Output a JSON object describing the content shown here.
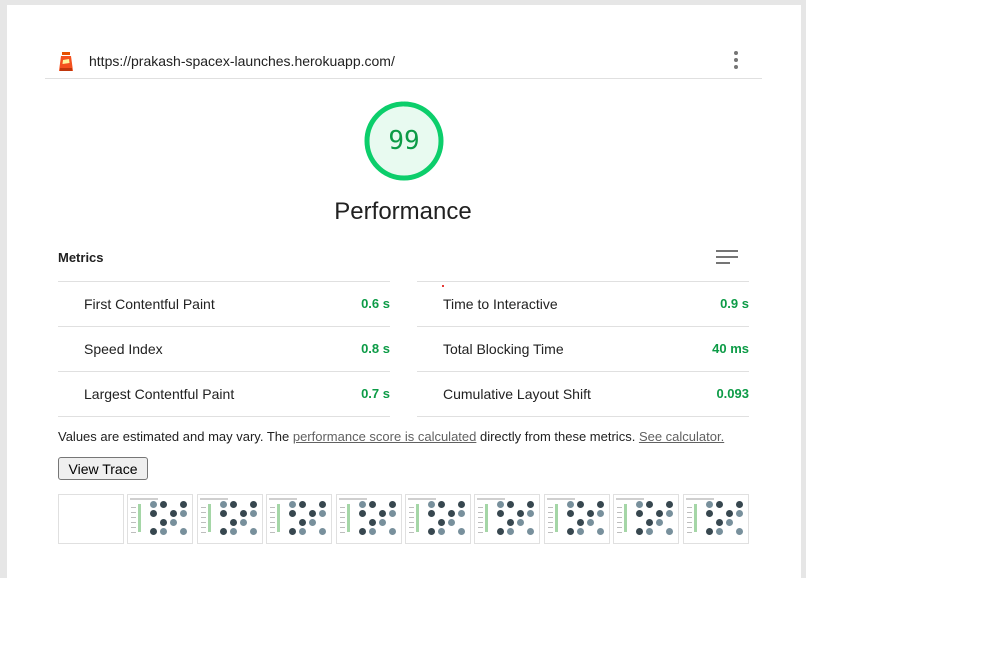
{
  "header": {
    "url": "https://prakash-spacex-launches.herokuapp.com/"
  },
  "gauge": {
    "score": "99",
    "score_fraction": 0.99,
    "title": "Performance",
    "color": "#0cce6b"
  },
  "metrics": {
    "heading": "Metrics",
    "left": [
      {
        "name": "First Contentful Paint",
        "value": "0.6 s"
      },
      {
        "name": "Speed Index",
        "value": "0.8 s"
      },
      {
        "name": "Largest Contentful Paint",
        "value": "0.7 s"
      }
    ],
    "right": [
      {
        "name": "Time to Interactive",
        "value": "0.9 s"
      },
      {
        "name": "Total Blocking Time",
        "value": "40 ms"
      },
      {
        "name": "Cumulative Layout Shift",
        "value": "0.093"
      }
    ],
    "pass_color": "#0c9b46"
  },
  "note": {
    "prefix": "Values are estimated and may vary. The ",
    "link1": "performance score is calculated",
    "middle": " directly from these metrics.",
    "link2": "See calculator."
  },
  "view_trace_label": "View Trace",
  "filmstrip_frames": 10
}
